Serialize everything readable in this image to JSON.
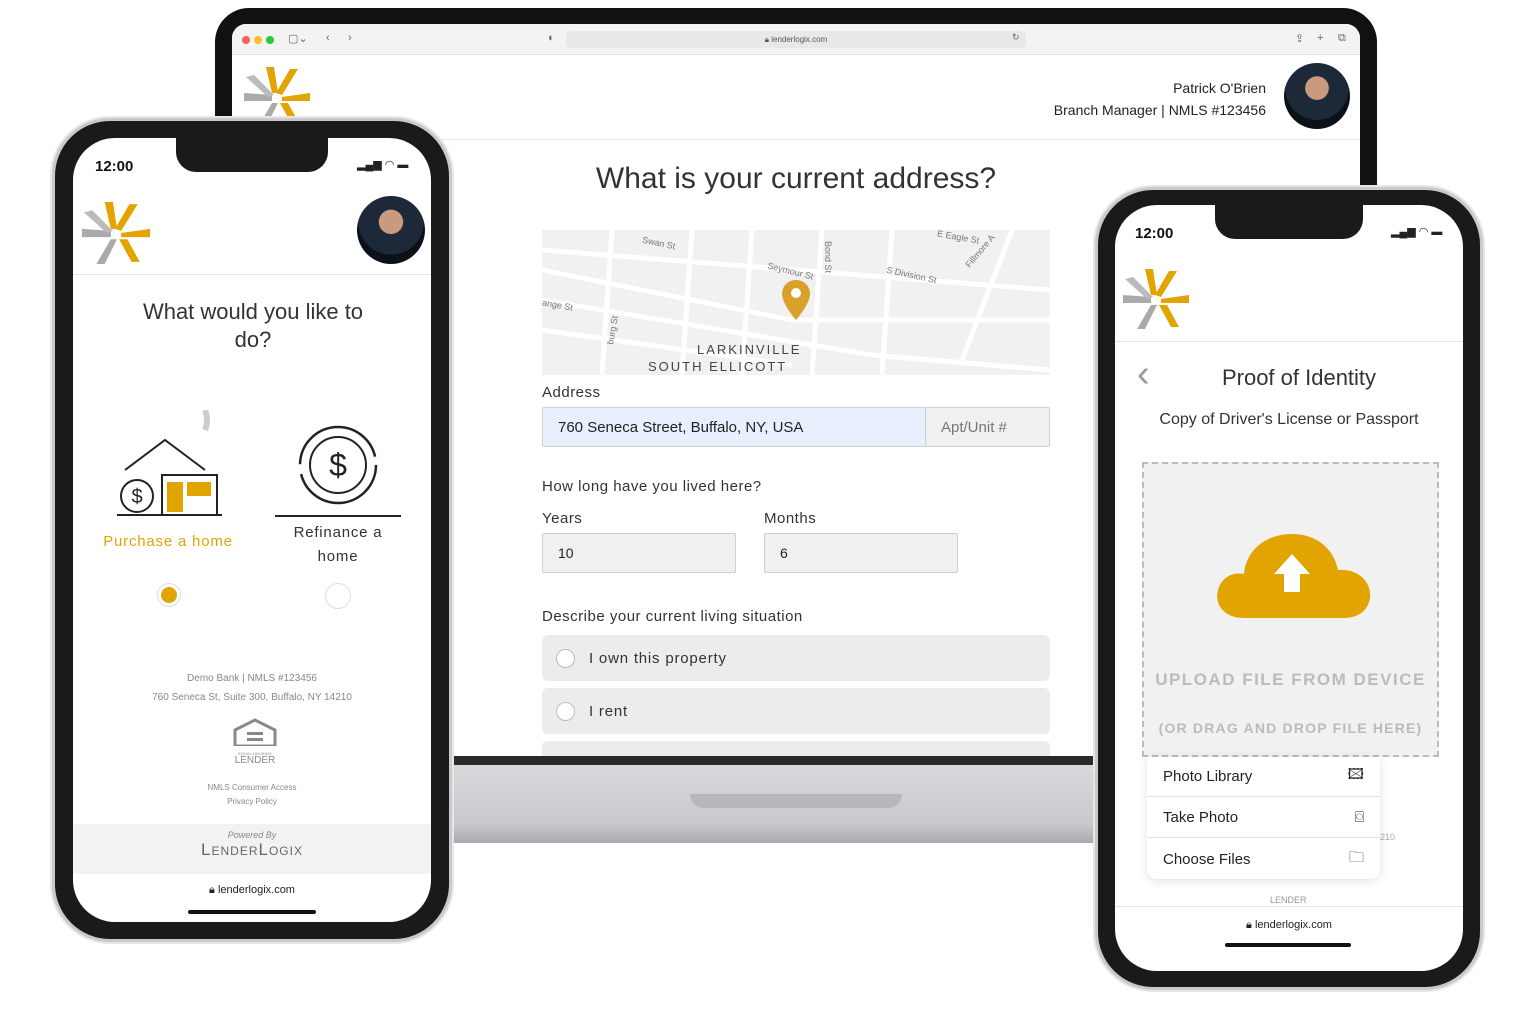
{
  "colors": {
    "accent": "#e2a400",
    "pin": "#d9a12a",
    "text": "#333333"
  },
  "laptop": {
    "browser": {
      "url": "lenderlogix.com",
      "icons": [
        "close-dot",
        "minimize-dot",
        "zoom-dot",
        "sidebar-icon",
        "back-icon",
        "forward-icon",
        "shield-icon",
        "reload-icon",
        "share-icon",
        "new-tab-icon",
        "tabs-icon"
      ]
    },
    "header": {
      "name": "Patrick O'Brien",
      "title": "Branch Manager | NMLS #123456"
    },
    "question": "What is your current address?",
    "map": {
      "streets": [
        "Swan St",
        "Seymour St",
        "Bond St",
        "S Division St",
        "E Eagle St",
        "Fillmore A",
        "ange St",
        "burg St"
      ],
      "areas": [
        "LARKINVILLE",
        "SOUTH ELLICOTT"
      ]
    },
    "address_label": "Address",
    "address_value": "760 Seneca Street, Buffalo, NY, USA",
    "apt_placeholder": "Apt/Unit #",
    "how_long": "How long have you lived here?",
    "years_label": "Years",
    "years_value": "10",
    "months_label": "Months",
    "months_value": "6",
    "situation_label": "Describe your current living situation",
    "options": [
      "I own this property",
      "I rent"
    ]
  },
  "left_phone": {
    "time": "12:00",
    "question": "What would you like to do?",
    "choices": [
      {
        "label": "Purchase a home",
        "selected": true
      },
      {
        "label": "Refinance a home",
        "selected": false
      }
    ],
    "footer": {
      "bank": "Demo Bank | NMLS #123456",
      "address": "760 Seneca St, Suite 300, Buffalo, NY 14210",
      "ehl_small": "EQUAL HOUSING",
      "ehl": "LENDER",
      "nmls_link": "NMLS Consumer Access",
      "privacy": "Privacy Policy",
      "powered": "Powered By",
      "brand": "LenderLogix"
    },
    "url": "lenderlogix.com"
  },
  "right_phone": {
    "time": "12:00",
    "title": "Proof of Identity",
    "subtitle": "Copy of Driver's License or Passport",
    "upload": "UPLOAD FILE FROM DEVICE",
    "drag": "(OR DRAG AND DROP FILE HERE)",
    "menu": [
      {
        "label": "Photo Library",
        "icon": "photo-library-icon"
      },
      {
        "label": "Take Photo",
        "icon": "camera-icon"
      },
      {
        "label": "Choose Files",
        "icon": "folder-icon"
      }
    ],
    "peek_text": "210",
    "ehl": "LENDER",
    "url": "lenderlogix.com"
  }
}
